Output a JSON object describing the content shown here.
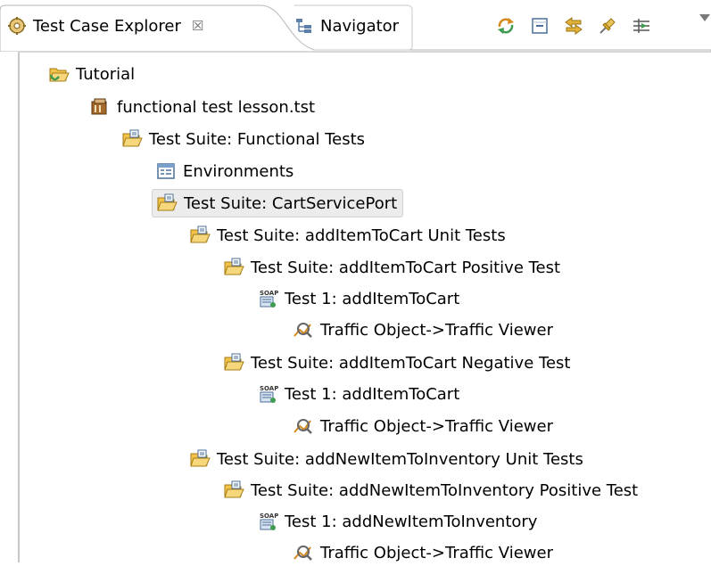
{
  "tabs": {
    "explorer_label": "Test Case Explorer",
    "explorer_close": "☒",
    "navigator_label": "Navigator"
  },
  "toolbar": {
    "buttons": [
      "sync-icon",
      "collapse-all-icon",
      "link-with-editor-icon",
      "pin-icon",
      "filter-icon"
    ],
    "view_menu": "view-menu-icon"
  },
  "tree": {
    "items": [
      {
        "label": "Tutorial",
        "icon": "open-folder-icon"
      },
      {
        "label": "functional test lesson.tst",
        "icon": "tst-file-icon"
      },
      {
        "label": "Test Suite: Functional Tests",
        "icon": "test-suite-icon"
      },
      {
        "label": "Environments",
        "icon": "environments-icon"
      },
      {
        "label": "Test Suite: CartServicePort",
        "icon": "test-suite-icon",
        "selected": true
      },
      {
        "label": "Test Suite: addItemToCart Unit Tests",
        "icon": "test-suite-icon"
      },
      {
        "label": "Test Suite: addItemToCart Positive Test",
        "icon": "test-suite-icon"
      },
      {
        "label": "Test 1: addItemToCart",
        "icon": "soap-client-icon"
      },
      {
        "label": "Traffic Object->Traffic Viewer",
        "icon": "traffic-viewer-icon"
      },
      {
        "label": "Test Suite: addItemToCart Negative Test",
        "icon": "test-suite-icon"
      },
      {
        "label": "Test 1: addItemToCart",
        "icon": "soap-client-icon"
      },
      {
        "label": "Traffic Object->Traffic Viewer",
        "icon": "traffic-viewer-icon"
      },
      {
        "label": "Test Suite: addNewItemToInventory Unit Tests",
        "icon": "test-suite-icon"
      },
      {
        "label": "Test Suite: addNewItemToInventory Positive Test",
        "icon": "test-suite-icon"
      },
      {
        "label": "Test 1: addNewItemToInventory",
        "icon": "soap-client-icon"
      },
      {
        "label": "Traffic Object->Traffic Viewer",
        "icon": "traffic-viewer-icon"
      }
    ]
  },
  "colors": {
    "selection_bg": "#ececec",
    "folder_yellow": "#f2c24b",
    "folder_green": "#3e9b4f"
  }
}
